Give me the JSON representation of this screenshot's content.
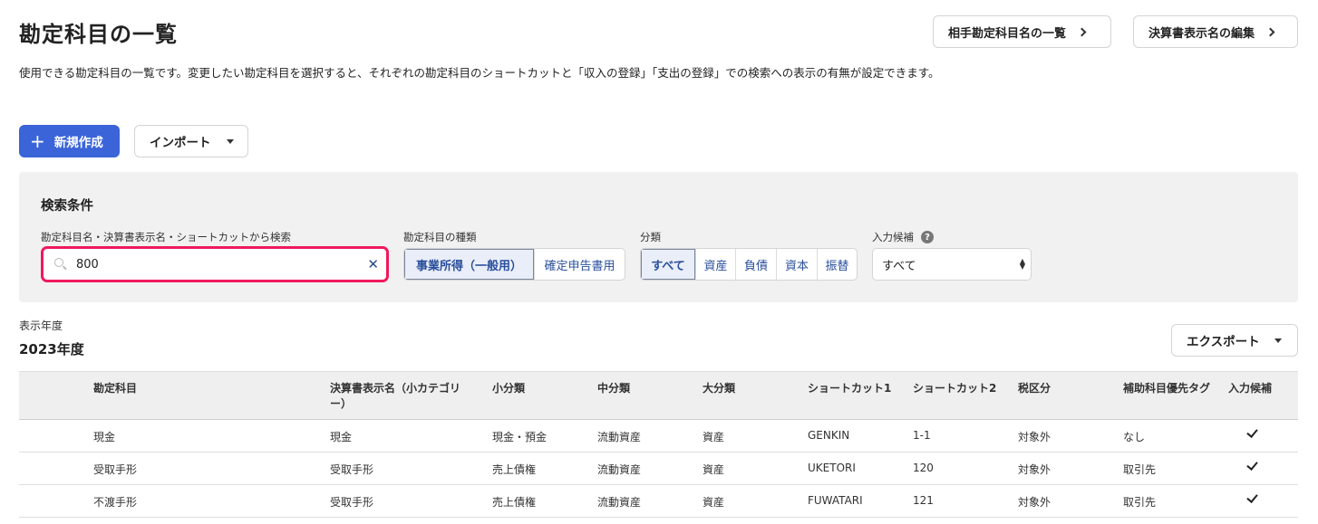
{
  "page": {
    "title": "勘定科目の一覧",
    "description": "使用できる勘定科目の一覧です。変更したい勘定科目を選択すると、それぞれの勘定科目のショートカットと「収入の登録」「支出の登録」での検索への表示の有無が設定できます。"
  },
  "header": {
    "partner_list_label": "相手勘定科目名の一覧",
    "statement_edit_label": "決算書表示名の編集"
  },
  "toolbar": {
    "new_label": "新規作成",
    "import_label": "インポート"
  },
  "search": {
    "title": "検索条件",
    "keyword_label": "勘定科目名・決算書表示名・ショートカットから検索",
    "keyword_value": "800",
    "type_label": "勘定科目の種類",
    "type_options": [
      "事業所得（一般用）",
      "確定申告書用"
    ],
    "category_label": "分類",
    "category_options": [
      "すべて",
      "資産",
      "負債",
      "資本",
      "振替"
    ],
    "candidate_label": "入力候補",
    "candidate_value": "すべて"
  },
  "year": {
    "label": "表示年度",
    "value": "2023年度"
  },
  "export_label": "エクスポート",
  "table": {
    "headers": [
      "勘定科目",
      "決算書表示名（小カテゴリー）",
      "小分類",
      "中分類",
      "大分類",
      "ショートカット1",
      "ショートカット2",
      "税区分",
      "補助科目優先タグ",
      "入力候補"
    ],
    "rows": [
      [
        "現金",
        "現金",
        "現金・預金",
        "流動資産",
        "資産",
        "GENKIN",
        "1-1",
        "対象外",
        "なし"
      ],
      [
        "受取手形",
        "受取手形",
        "売上債権",
        "流動資産",
        "資産",
        "UKETORI",
        "120",
        "対象外",
        "取引先"
      ],
      [
        "不渡手形",
        "受取手形",
        "売上債権",
        "流動資産",
        "資産",
        "FUWATARI",
        "121",
        "対象外",
        "取引先"
      ]
    ]
  }
}
